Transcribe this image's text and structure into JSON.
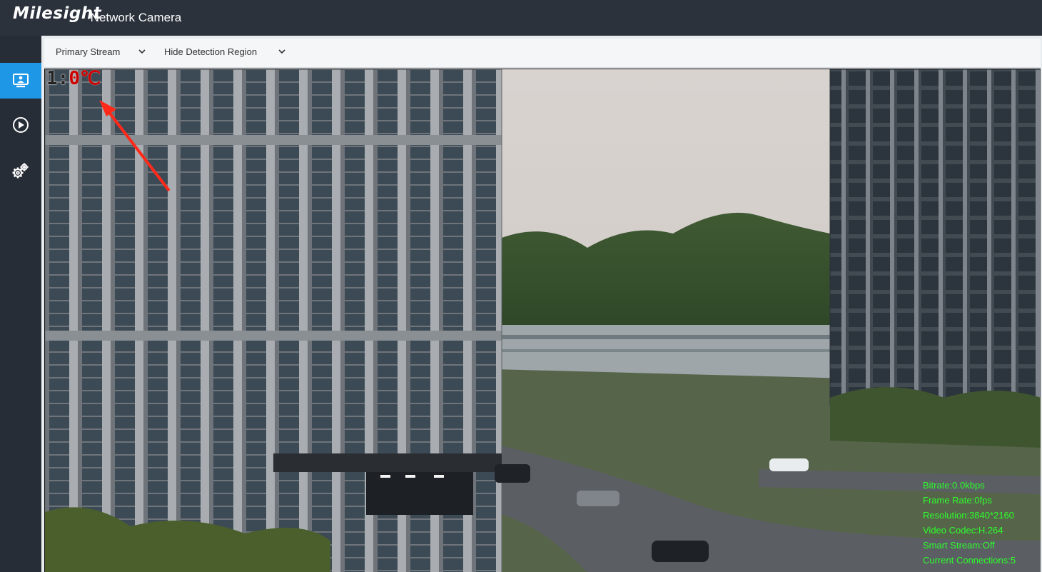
{
  "header": {
    "brand": "Milesight",
    "product": "·Network Camera"
  },
  "sidebar": {
    "items": [
      {
        "id": "live-view",
        "icon": "monitor-user-icon",
        "active": true
      },
      {
        "id": "playback",
        "icon": "play-circle-icon",
        "active": false
      },
      {
        "id": "settings",
        "icon": "gears-icon",
        "active": false
      }
    ]
  },
  "toolbar": {
    "stream": "Primary Stream",
    "region": "Hide Detection Region"
  },
  "video": {
    "osd": {
      "channel": "1:",
      "temperature": "0℃"
    },
    "stats": [
      "Bitrate:0.0kbps",
      "Frame Rate:0fps",
      "Resolution:3840*2160",
      "Video Codec:H.264",
      "Smart Stream:Off",
      "Current Connections:5"
    ]
  },
  "colors": {
    "accent": "#1e97e6",
    "header": "#2b323c",
    "osd_green": "#2dff2d",
    "osd_red": "#cc0000"
  }
}
